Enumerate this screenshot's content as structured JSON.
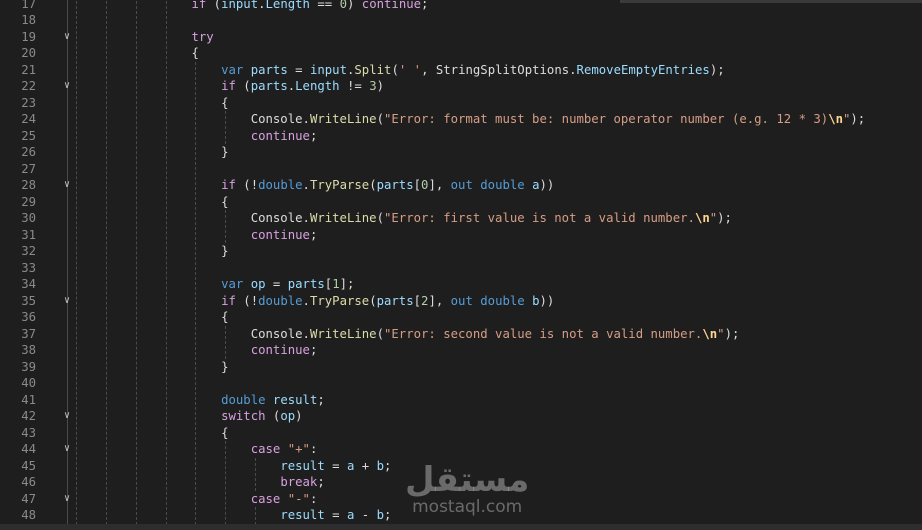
{
  "editor": {
    "first_line_number": 17,
    "fold_lines": [
      19,
      22,
      28,
      35,
      42,
      44,
      47
    ],
    "lines": [
      [
        [
          "ctl",
          "if"
        ],
        [
          "pl",
          " ("
        ],
        [
          "var",
          "input"
        ],
        [
          "pl",
          "."
        ],
        [
          "var",
          "Length"
        ],
        [
          "pl",
          " == "
        ],
        [
          "num",
          "0"
        ],
        [
          "pl",
          ") "
        ],
        [
          "ctl",
          "continue"
        ],
        [
          "pl",
          ";"
        ]
      ],
      [],
      [
        [
          "ctl",
          "try"
        ]
      ],
      [
        [
          "pl",
          "{"
        ]
      ],
      [
        [
          "pl",
          "    "
        ],
        [
          "kw",
          "var"
        ],
        [
          "pl",
          " "
        ],
        [
          "var",
          "parts"
        ],
        [
          "pl",
          " = "
        ],
        [
          "var",
          "input"
        ],
        [
          "pl",
          "."
        ],
        [
          "fn",
          "Split"
        ],
        [
          "pl",
          "("
        ],
        [
          "str",
          "' '"
        ],
        [
          "pl",
          ", StringSplitOptions."
        ],
        [
          "var",
          "RemoveEmptyEntries"
        ],
        [
          "pl",
          ");"
        ]
      ],
      [
        [
          "pl",
          "    "
        ],
        [
          "ctl",
          "if"
        ],
        [
          "pl",
          " ("
        ],
        [
          "var",
          "parts"
        ],
        [
          "pl",
          "."
        ],
        [
          "var",
          "Length"
        ],
        [
          "pl",
          " != "
        ],
        [
          "num",
          "3"
        ],
        [
          "pl",
          ")"
        ]
      ],
      [
        [
          "pl",
          "    {"
        ]
      ],
      [
        [
          "pl",
          "        Console."
        ],
        [
          "fn",
          "WriteLine"
        ],
        [
          "pl",
          "("
        ],
        [
          "str",
          "\"Error: format must be: number operator number (e.g. 12 * 3)"
        ],
        [
          "esc",
          "\\n"
        ],
        [
          "str",
          "\""
        ],
        [
          "pl",
          ");"
        ]
      ],
      [
        [
          "pl",
          "        "
        ],
        [
          "ctl",
          "continue"
        ],
        [
          "pl",
          ";"
        ]
      ],
      [
        [
          "pl",
          "    }"
        ]
      ],
      [],
      [
        [
          "pl",
          "    "
        ],
        [
          "ctl",
          "if"
        ],
        [
          "pl",
          " (!"
        ],
        [
          "kw",
          "double"
        ],
        [
          "pl",
          "."
        ],
        [
          "fn",
          "TryParse"
        ],
        [
          "pl",
          "("
        ],
        [
          "var",
          "parts"
        ],
        [
          "pl",
          "["
        ],
        [
          "num",
          "0"
        ],
        [
          "pl",
          "], "
        ],
        [
          "kw",
          "out"
        ],
        [
          "pl",
          " "
        ],
        [
          "kw",
          "double"
        ],
        [
          "pl",
          " "
        ],
        [
          "var",
          "a"
        ],
        [
          "pl",
          "))"
        ]
      ],
      [
        [
          "pl",
          "    {"
        ]
      ],
      [
        [
          "pl",
          "        Console."
        ],
        [
          "fn",
          "WriteLine"
        ],
        [
          "pl",
          "("
        ],
        [
          "str",
          "\"Error: first value is not a valid number."
        ],
        [
          "esc",
          "\\n"
        ],
        [
          "str",
          "\""
        ],
        [
          "pl",
          ");"
        ]
      ],
      [
        [
          "pl",
          "        "
        ],
        [
          "ctl",
          "continue"
        ],
        [
          "pl",
          ";"
        ]
      ],
      [
        [
          "pl",
          "    }"
        ]
      ],
      [],
      [
        [
          "pl",
          "    "
        ],
        [
          "kw",
          "var"
        ],
        [
          "pl",
          " "
        ],
        [
          "var",
          "op"
        ],
        [
          "pl",
          " = "
        ],
        [
          "var",
          "parts"
        ],
        [
          "pl",
          "["
        ],
        [
          "num",
          "1"
        ],
        [
          "pl",
          "];"
        ]
      ],
      [
        [
          "pl",
          "    "
        ],
        [
          "ctl",
          "if"
        ],
        [
          "pl",
          " (!"
        ],
        [
          "kw",
          "double"
        ],
        [
          "pl",
          "."
        ],
        [
          "fn",
          "TryParse"
        ],
        [
          "pl",
          "("
        ],
        [
          "var",
          "parts"
        ],
        [
          "pl",
          "["
        ],
        [
          "num",
          "2"
        ],
        [
          "pl",
          "], "
        ],
        [
          "kw",
          "out"
        ],
        [
          "pl",
          " "
        ],
        [
          "kw",
          "double"
        ],
        [
          "pl",
          " "
        ],
        [
          "var",
          "b"
        ],
        [
          "pl",
          "))"
        ]
      ],
      [
        [
          "pl",
          "    {"
        ]
      ],
      [
        [
          "pl",
          "        Console."
        ],
        [
          "fn",
          "WriteLine"
        ],
        [
          "pl",
          "("
        ],
        [
          "str",
          "\"Error: second value is not a valid number."
        ],
        [
          "esc",
          "\\n"
        ],
        [
          "str",
          "\""
        ],
        [
          "pl",
          ");"
        ]
      ],
      [
        [
          "pl",
          "        "
        ],
        [
          "ctl",
          "continue"
        ],
        [
          "pl",
          ";"
        ]
      ],
      [
        [
          "pl",
          "    }"
        ]
      ],
      [],
      [
        [
          "pl",
          "    "
        ],
        [
          "kw",
          "double"
        ],
        [
          "pl",
          " "
        ],
        [
          "var",
          "result"
        ],
        [
          "pl",
          ";"
        ]
      ],
      [
        [
          "pl",
          "    "
        ],
        [
          "ctl",
          "switch"
        ],
        [
          "pl",
          " ("
        ],
        [
          "var",
          "op"
        ],
        [
          "pl",
          ")"
        ]
      ],
      [
        [
          "pl",
          "    {"
        ]
      ],
      [
        [
          "pl",
          "        "
        ],
        [
          "ctl",
          "case"
        ],
        [
          "pl",
          " "
        ],
        [
          "str",
          "\"+\""
        ],
        [
          "pl",
          ":"
        ]
      ],
      [
        [
          "pl",
          "            "
        ],
        [
          "var",
          "result"
        ],
        [
          "pl",
          " = "
        ],
        [
          "var",
          "a"
        ],
        [
          "pl",
          " + "
        ],
        [
          "var",
          "b"
        ],
        [
          "pl",
          ";"
        ]
      ],
      [
        [
          "pl",
          "            "
        ],
        [
          "ctl",
          "break"
        ],
        [
          "pl",
          ";"
        ]
      ],
      [
        [
          "pl",
          "        "
        ],
        [
          "ctl",
          "case"
        ],
        [
          "pl",
          " "
        ],
        [
          "str",
          "\"-\""
        ],
        [
          "pl",
          ":"
        ]
      ],
      [
        [
          "pl",
          "            "
        ],
        [
          "var",
          "result"
        ],
        [
          "pl",
          " = "
        ],
        [
          "var",
          "a"
        ],
        [
          "pl",
          " - "
        ],
        [
          "var",
          "b"
        ],
        [
          "pl",
          ";"
        ]
      ]
    ]
  },
  "watermark": {
    "arabic": "مستقل",
    "latin": "mostaql.com"
  }
}
